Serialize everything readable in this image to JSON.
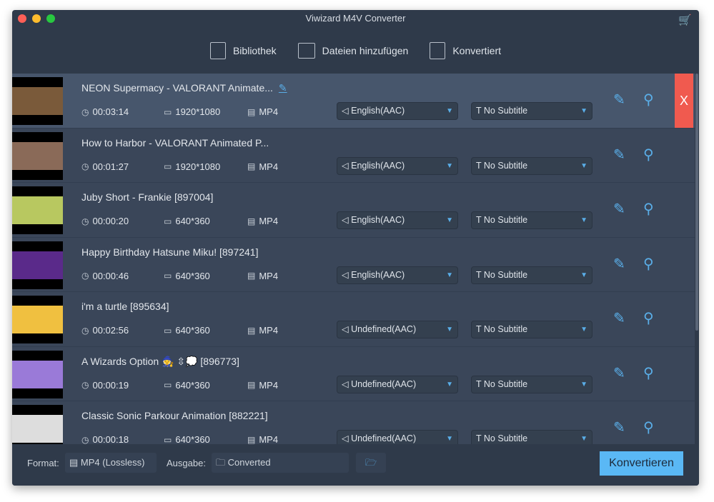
{
  "window": {
    "title": "Viwizard M4V Converter"
  },
  "toolbar": {
    "library": "Bibliothek",
    "add_files": "Dateien hinzufügen",
    "converted": "Konvertiert"
  },
  "items": [
    {
      "title": "NEON Supermacy - VALORANT Animate...",
      "duration": "00:03:14",
      "resolution": "1920*1080",
      "format": "MP4",
      "audio": "English(AAC)",
      "subtitle": "No Subtitle",
      "thumb": "#7a5a3a"
    },
    {
      "title": "How to Harbor - VALORANT Animated P...",
      "duration": "00:01:27",
      "resolution": "1920*1080",
      "format": "MP4",
      "audio": "English(AAC)",
      "subtitle": "No Subtitle",
      "thumb": "#8a6a58"
    },
    {
      "title": "Juby Short - Frankie [897004]",
      "duration": "00:00:20",
      "resolution": "640*360",
      "format": "MP4",
      "audio": "English(AAC)",
      "subtitle": "No Subtitle",
      "thumb": "#b8c860"
    },
    {
      "title": "Happy Birthday Hatsune Miku! [897241]",
      "duration": "00:00:46",
      "resolution": "640*360",
      "format": "MP4",
      "audio": "English(AAC)",
      "subtitle": "No Subtitle",
      "thumb": "#5a2a8a"
    },
    {
      "title": "i'm a turtle [895634]",
      "duration": "00:02:56",
      "resolution": "640*360",
      "format": "MP4",
      "audio": "Undefined(AAC)",
      "subtitle": "No Subtitle",
      "thumb": "#f0c040"
    },
    {
      "title": "A Wizards Option 🧙 ⇳💭 [896773]",
      "duration": "00:00:19",
      "resolution": "640*360",
      "format": "MP4",
      "audio": "Undefined(AAC)",
      "subtitle": "No Subtitle",
      "thumb": "#9a7ad8"
    },
    {
      "title": "Classic Sonic Parkour Animation [882221]",
      "duration": "00:00:18",
      "resolution": "640*360",
      "format": "MP4",
      "audio": "Undefined(AAC)",
      "subtitle": "No Subtitle",
      "thumb": "#dddddd"
    }
  ],
  "footer": {
    "format_label": "Format:",
    "format_value": "MP4 (Lossless)",
    "output_label": "Ausgabe:",
    "output_value": "Converted",
    "convert": "Konvertieren"
  },
  "icons": {
    "delete": "X"
  }
}
